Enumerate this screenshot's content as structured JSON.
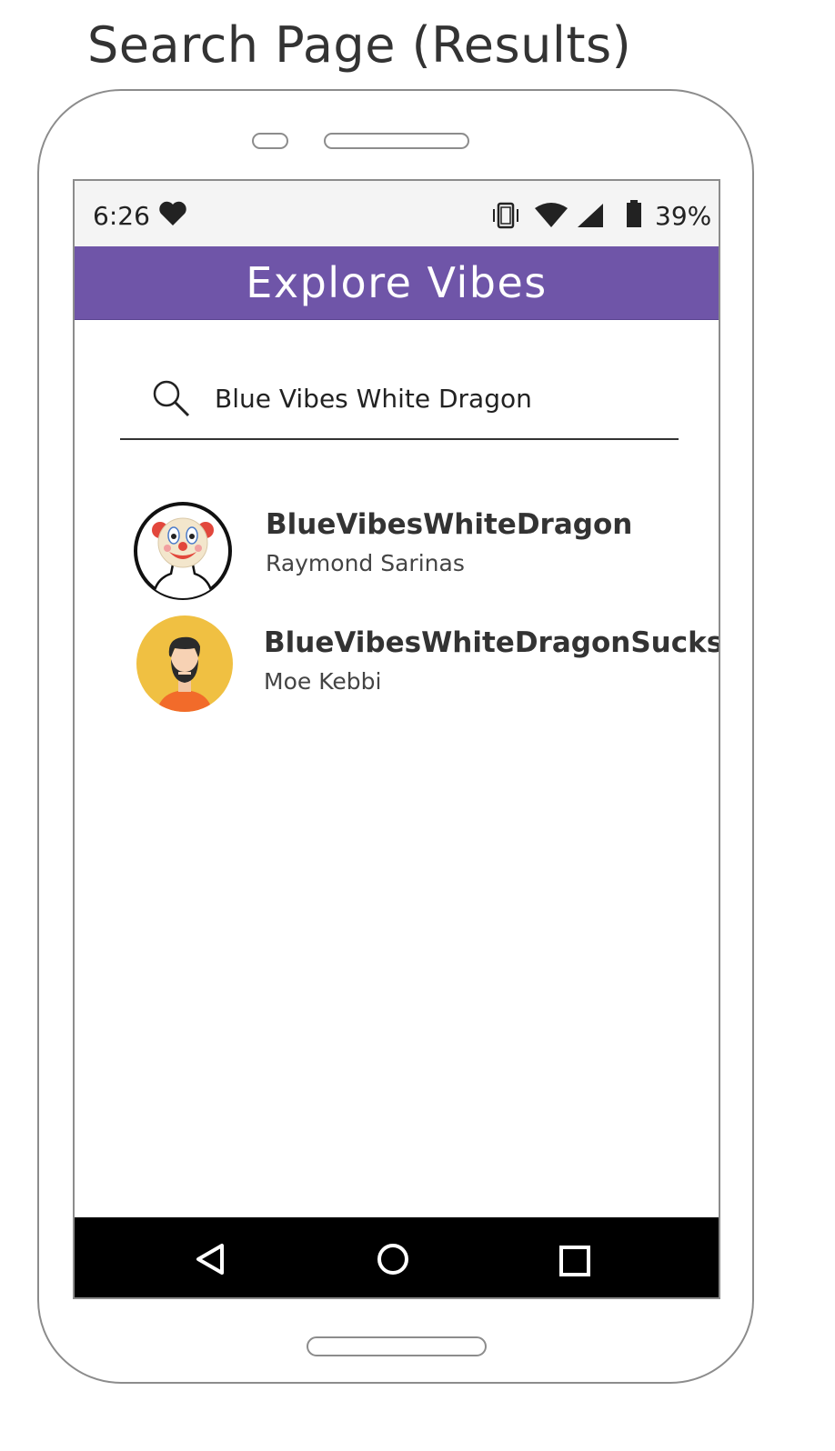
{
  "page_title": "Search Page (Results)",
  "status_bar": {
    "time": "6:26",
    "battery_percent": "39%",
    "icons": [
      "heart-icon",
      "vibrate-icon",
      "wifi-icon",
      "cell-signal-icon",
      "battery-icon"
    ]
  },
  "app_bar": {
    "title": "Explore Vibes",
    "color": "#6f55a8"
  },
  "search": {
    "value": "Blue Vibes White Dragon",
    "icon": "search-icon"
  },
  "results": [
    {
      "handle": "BlueVibesWhiteDragon",
      "name": "Raymond Sarinas",
      "avatar": "clown-avatar"
    },
    {
      "handle": "BlueVibesWhiteDragonSucks",
      "name": "Moe Kebbi",
      "avatar": "bearded-man-avatar"
    }
  ],
  "nav_bar": {
    "icons": [
      "back-icon",
      "home-icon",
      "recents-icon"
    ]
  }
}
